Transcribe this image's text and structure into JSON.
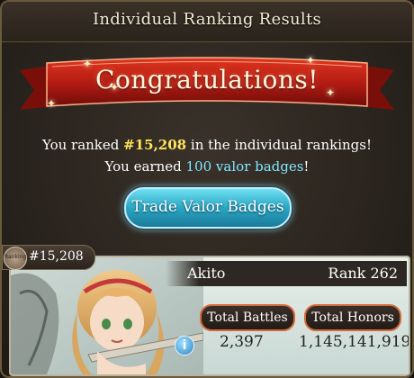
{
  "header": {
    "title": "Individual Ranking Results"
  },
  "banner": {
    "text": "Congratulations!"
  },
  "messages": {
    "line1_prefix": "You ranked ",
    "line1_rank": "#15,208",
    "line1_suffix": " in the individual rankings!",
    "line2_prefix": "You earned ",
    "line2_badges": "100 valor badges",
    "line2_suffix": "!"
  },
  "trade_button": {
    "label": "Trade Valor Badges"
  },
  "ranking_tag": {
    "medal_text": "Ranking",
    "rank": "#15,208"
  },
  "player": {
    "name": "Akito",
    "rank_label": "Rank 262",
    "total_battles_label": "Total Battles",
    "total_honors_label": "Total Honors",
    "total_battles": "2,397",
    "total_honors": "1,145,141,919"
  },
  "icons": {
    "info": "info-icon",
    "medal": "ranking-medal-icon"
  },
  "colors": {
    "banner_red": "#b01a12",
    "highlight_yellow": "#ffe45c",
    "highlight_cyan": "#7fe8ff",
    "button_cyan": "#2aa6c4",
    "pill_border": "#d46a3c"
  }
}
